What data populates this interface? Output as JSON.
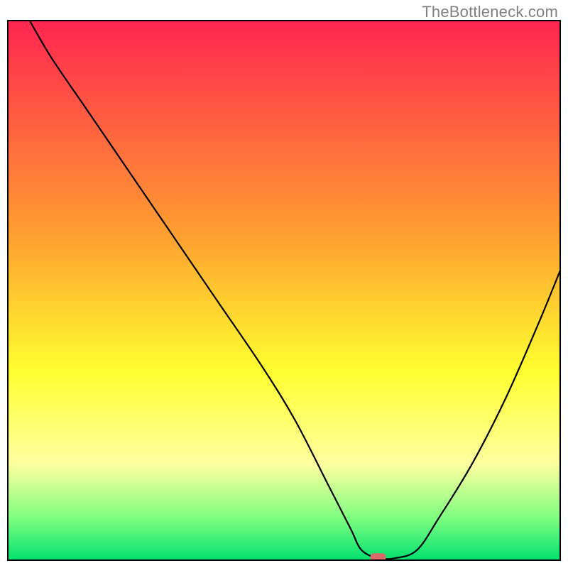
{
  "watermark": "TheBottleneck.com",
  "colors": {
    "red": "#ff2550",
    "orange": "#ffa030",
    "yellow": "#ffff30",
    "paleyellow": "#ffffa0",
    "lightgreen": "#80ff80",
    "green": "#00e070",
    "border": "#000000",
    "marker": "#d86a6a",
    "curve": "#000000"
  },
  "chart_data": {
    "type": "line",
    "title": "",
    "xlabel": "",
    "ylabel": "",
    "xlim": [
      0,
      100
    ],
    "ylim": [
      0,
      100
    ],
    "series": [
      {
        "name": "bottleneck-curve",
        "x": [
          4,
          8,
          14,
          22,
          30,
          38,
          46,
          52,
          58,
          62,
          64,
          67,
          70,
          74,
          78,
          84,
          90,
          96,
          100
        ],
        "y": [
          100,
          93,
          84,
          72,
          60,
          48,
          36,
          26,
          14,
          6,
          2,
          0.5,
          0.5,
          2,
          8,
          18,
          30,
          44,
          54
        ]
      }
    ],
    "marker": {
      "x": 67,
      "y": 0.7
    },
    "gradient_stops": [
      {
        "pos": 0,
        "color": "#ff2550"
      },
      {
        "pos": 40,
        "color": "#ffa030"
      },
      {
        "pos": 65,
        "color": "#ffff30"
      },
      {
        "pos": 82,
        "color": "#ffffa0"
      },
      {
        "pos": 92,
        "color": "#80ff80"
      },
      {
        "pos": 100,
        "color": "#00e070"
      }
    ]
  }
}
